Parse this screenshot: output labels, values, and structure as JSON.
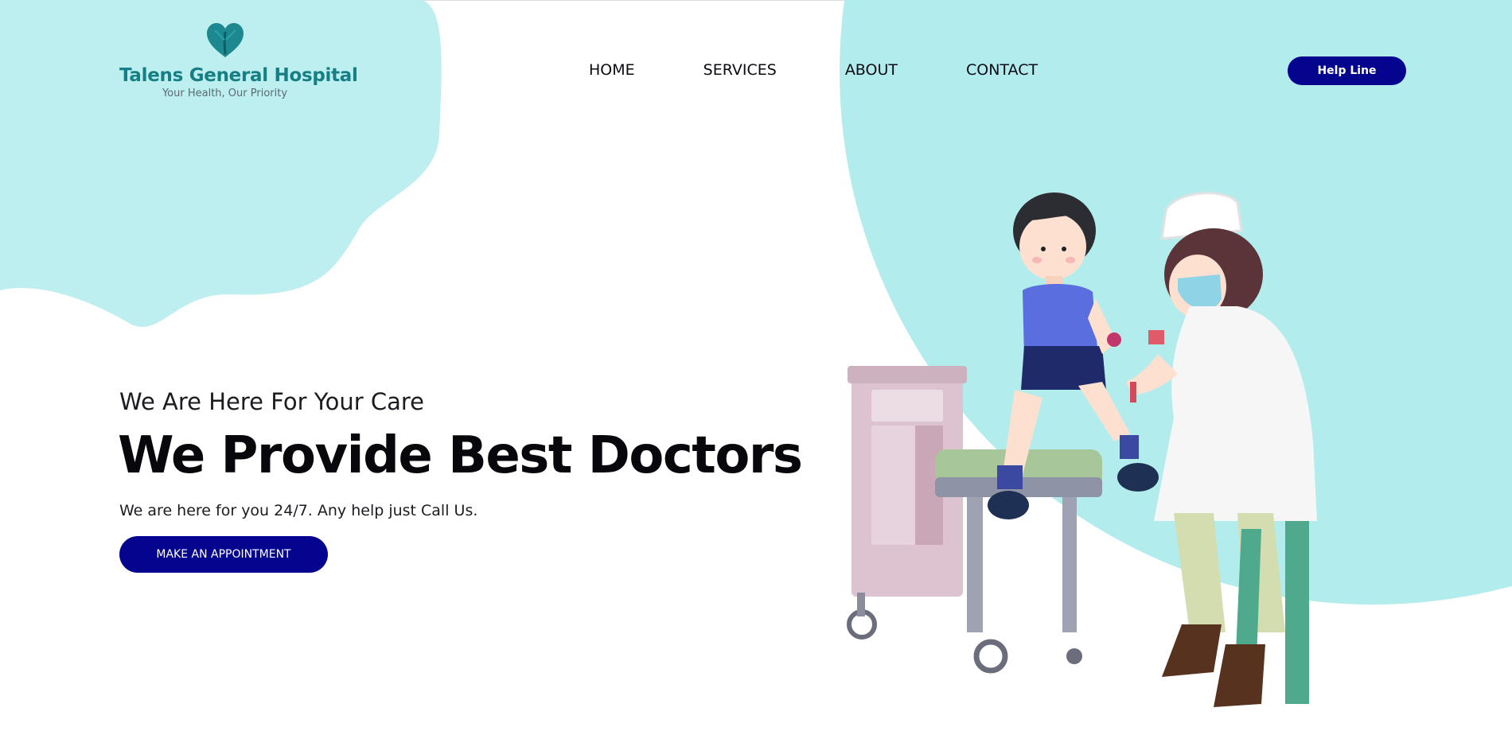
{
  "brand": {
    "name": "Talens General Hospital",
    "tagline": "Your Health, Our Priority",
    "logo_icon": "heart-icon"
  },
  "nav": {
    "items": [
      {
        "label": "HOME"
      },
      {
        "label": "SERVICES"
      },
      {
        "label": "ABOUT"
      },
      {
        "label": "CONTACT"
      }
    ],
    "helpline_label": "Help Line"
  },
  "hero": {
    "subtitle": "We Are Here For Your Care",
    "title": "We Provide Best Doctors",
    "description": "We are here for you 24/7. Any help just Call Us.",
    "cta_label": "MAKE AN APPOINTMENT"
  },
  "colors": {
    "primary": "#05048e",
    "accent_teal": "#167f84",
    "bg_light_teal": "#b3ecec"
  }
}
